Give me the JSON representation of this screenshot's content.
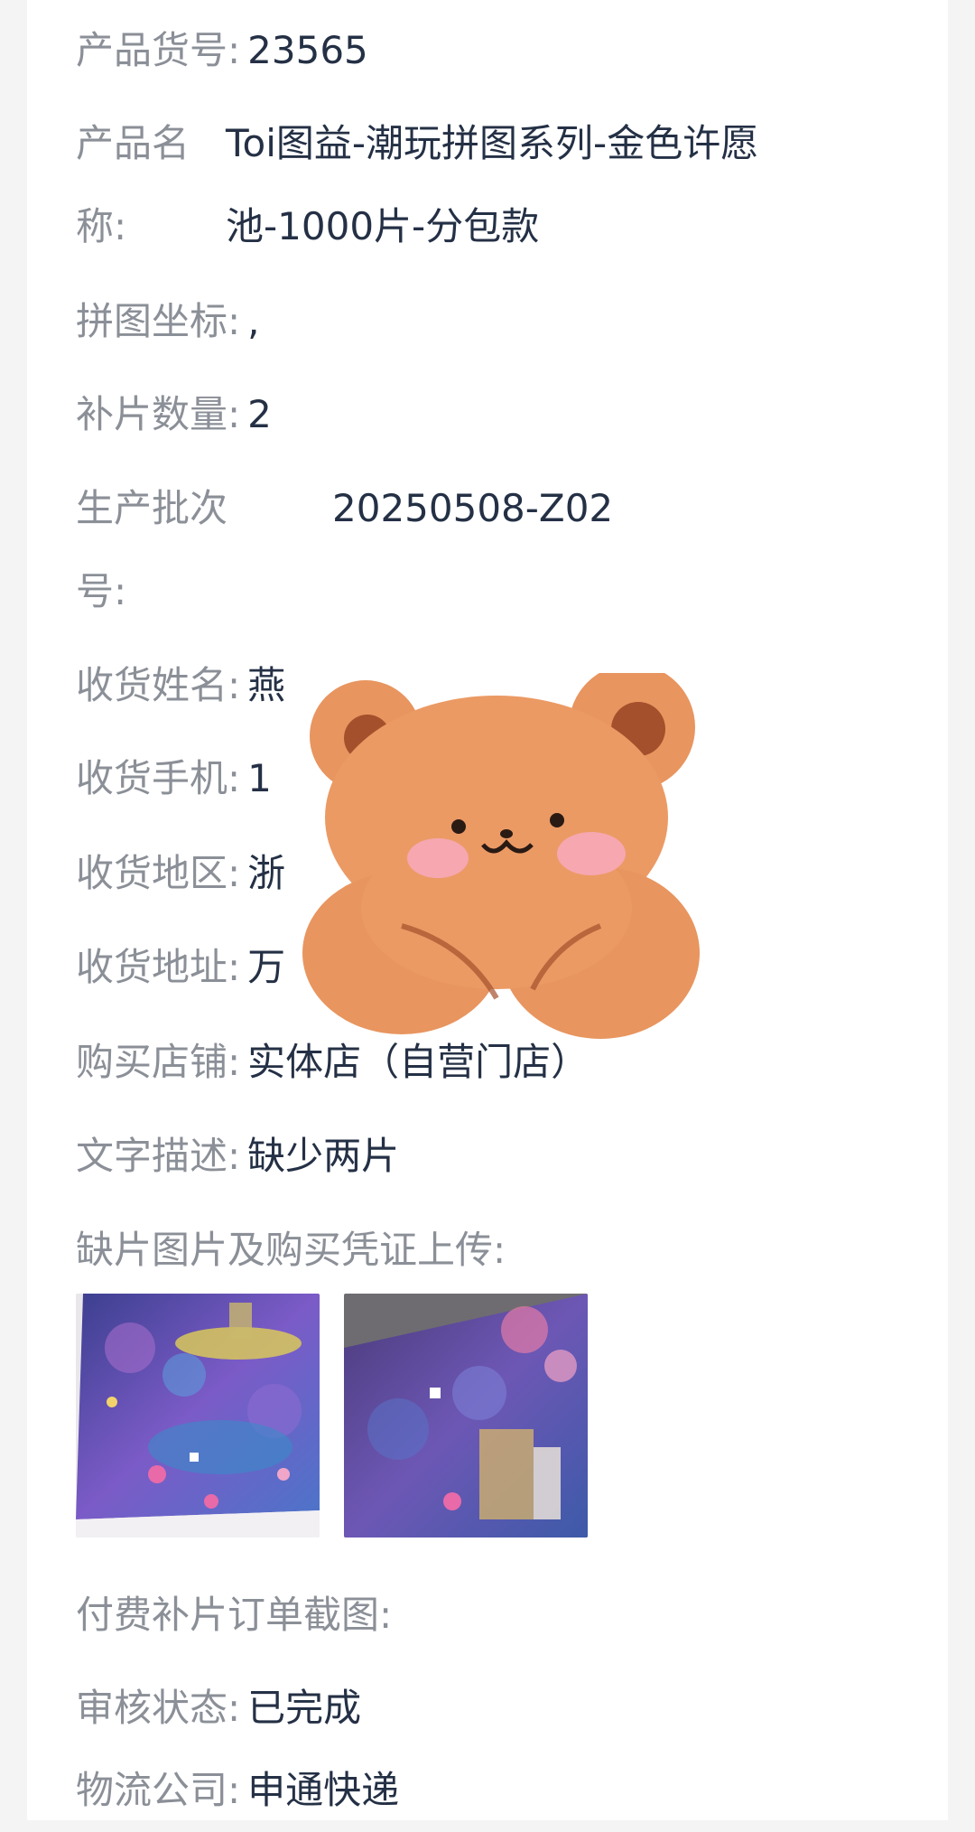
{
  "fields": {
    "product_no": {
      "label": "产品货号:",
      "value": "23565"
    },
    "product_name": {
      "label_line1": "产品名",
      "label_line2": "称:",
      "value_line1": "Toi图益-潮玩拼图系列-金色许愿",
      "value_line2": "池-1000片-分包款"
    },
    "coords": {
      "label": "拼图坐标:",
      "value": ","
    },
    "qty": {
      "label": "补片数量:",
      "value": "2"
    },
    "batch": {
      "label_line1": "生产批次",
      "label_line2": "号:",
      "value": "20250508-Z02"
    },
    "recv_name": {
      "label": "收货姓名:",
      "value": "燕"
    },
    "recv_phone": {
      "label": "收货手机:",
      "value": "1"
    },
    "recv_region": {
      "label": "收货地区:",
      "value": "浙"
    },
    "recv_addr": {
      "label": "收货地址:",
      "value": "万"
    },
    "store": {
      "label": "购买店铺:",
      "value": "实体店（自营门店）"
    },
    "desc": {
      "label": "文字描述:",
      "value": "缺少两片"
    },
    "upload": {
      "label": "缺片图片及购买凭证上传:"
    },
    "paid_screenshot": {
      "label": "付费补片订单截图:"
    },
    "review": {
      "label": "审核状态:",
      "value": "已完成"
    },
    "logistics": {
      "label": "物流公司:",
      "value": "申通快递"
    }
  },
  "colors": {
    "label": "#8b8f97",
    "value": "#243045",
    "bear": "#e8955f",
    "bear_ear": "#a5502c",
    "cheek": "#f6a7b0"
  }
}
